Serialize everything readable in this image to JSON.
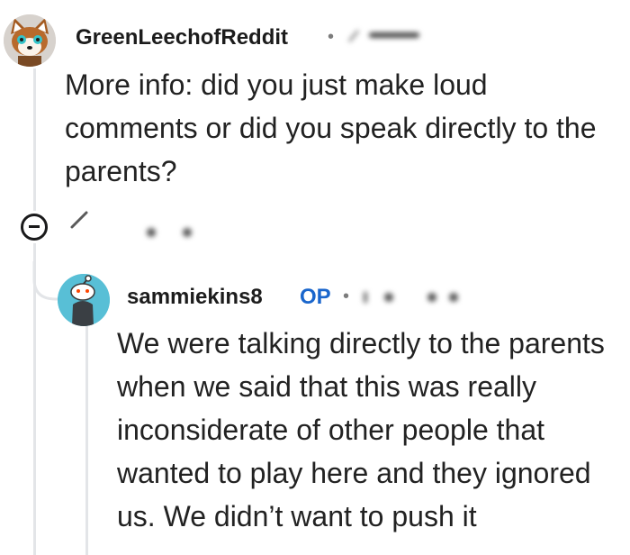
{
  "comments": [
    {
      "username": "GreenLeechofReddit",
      "meta_separator": "•",
      "text": "More info: did you just make loud comments or did you speak directly to the parents?"
    },
    {
      "username": "sammiekins8",
      "op_badge": "OP",
      "meta_separator": "•",
      "text": "We were talking directly to the parents when we said that this was really inconsiderate of other people that wanted to play here and they ignored us. We didn’t want to push it"
    }
  ]
}
